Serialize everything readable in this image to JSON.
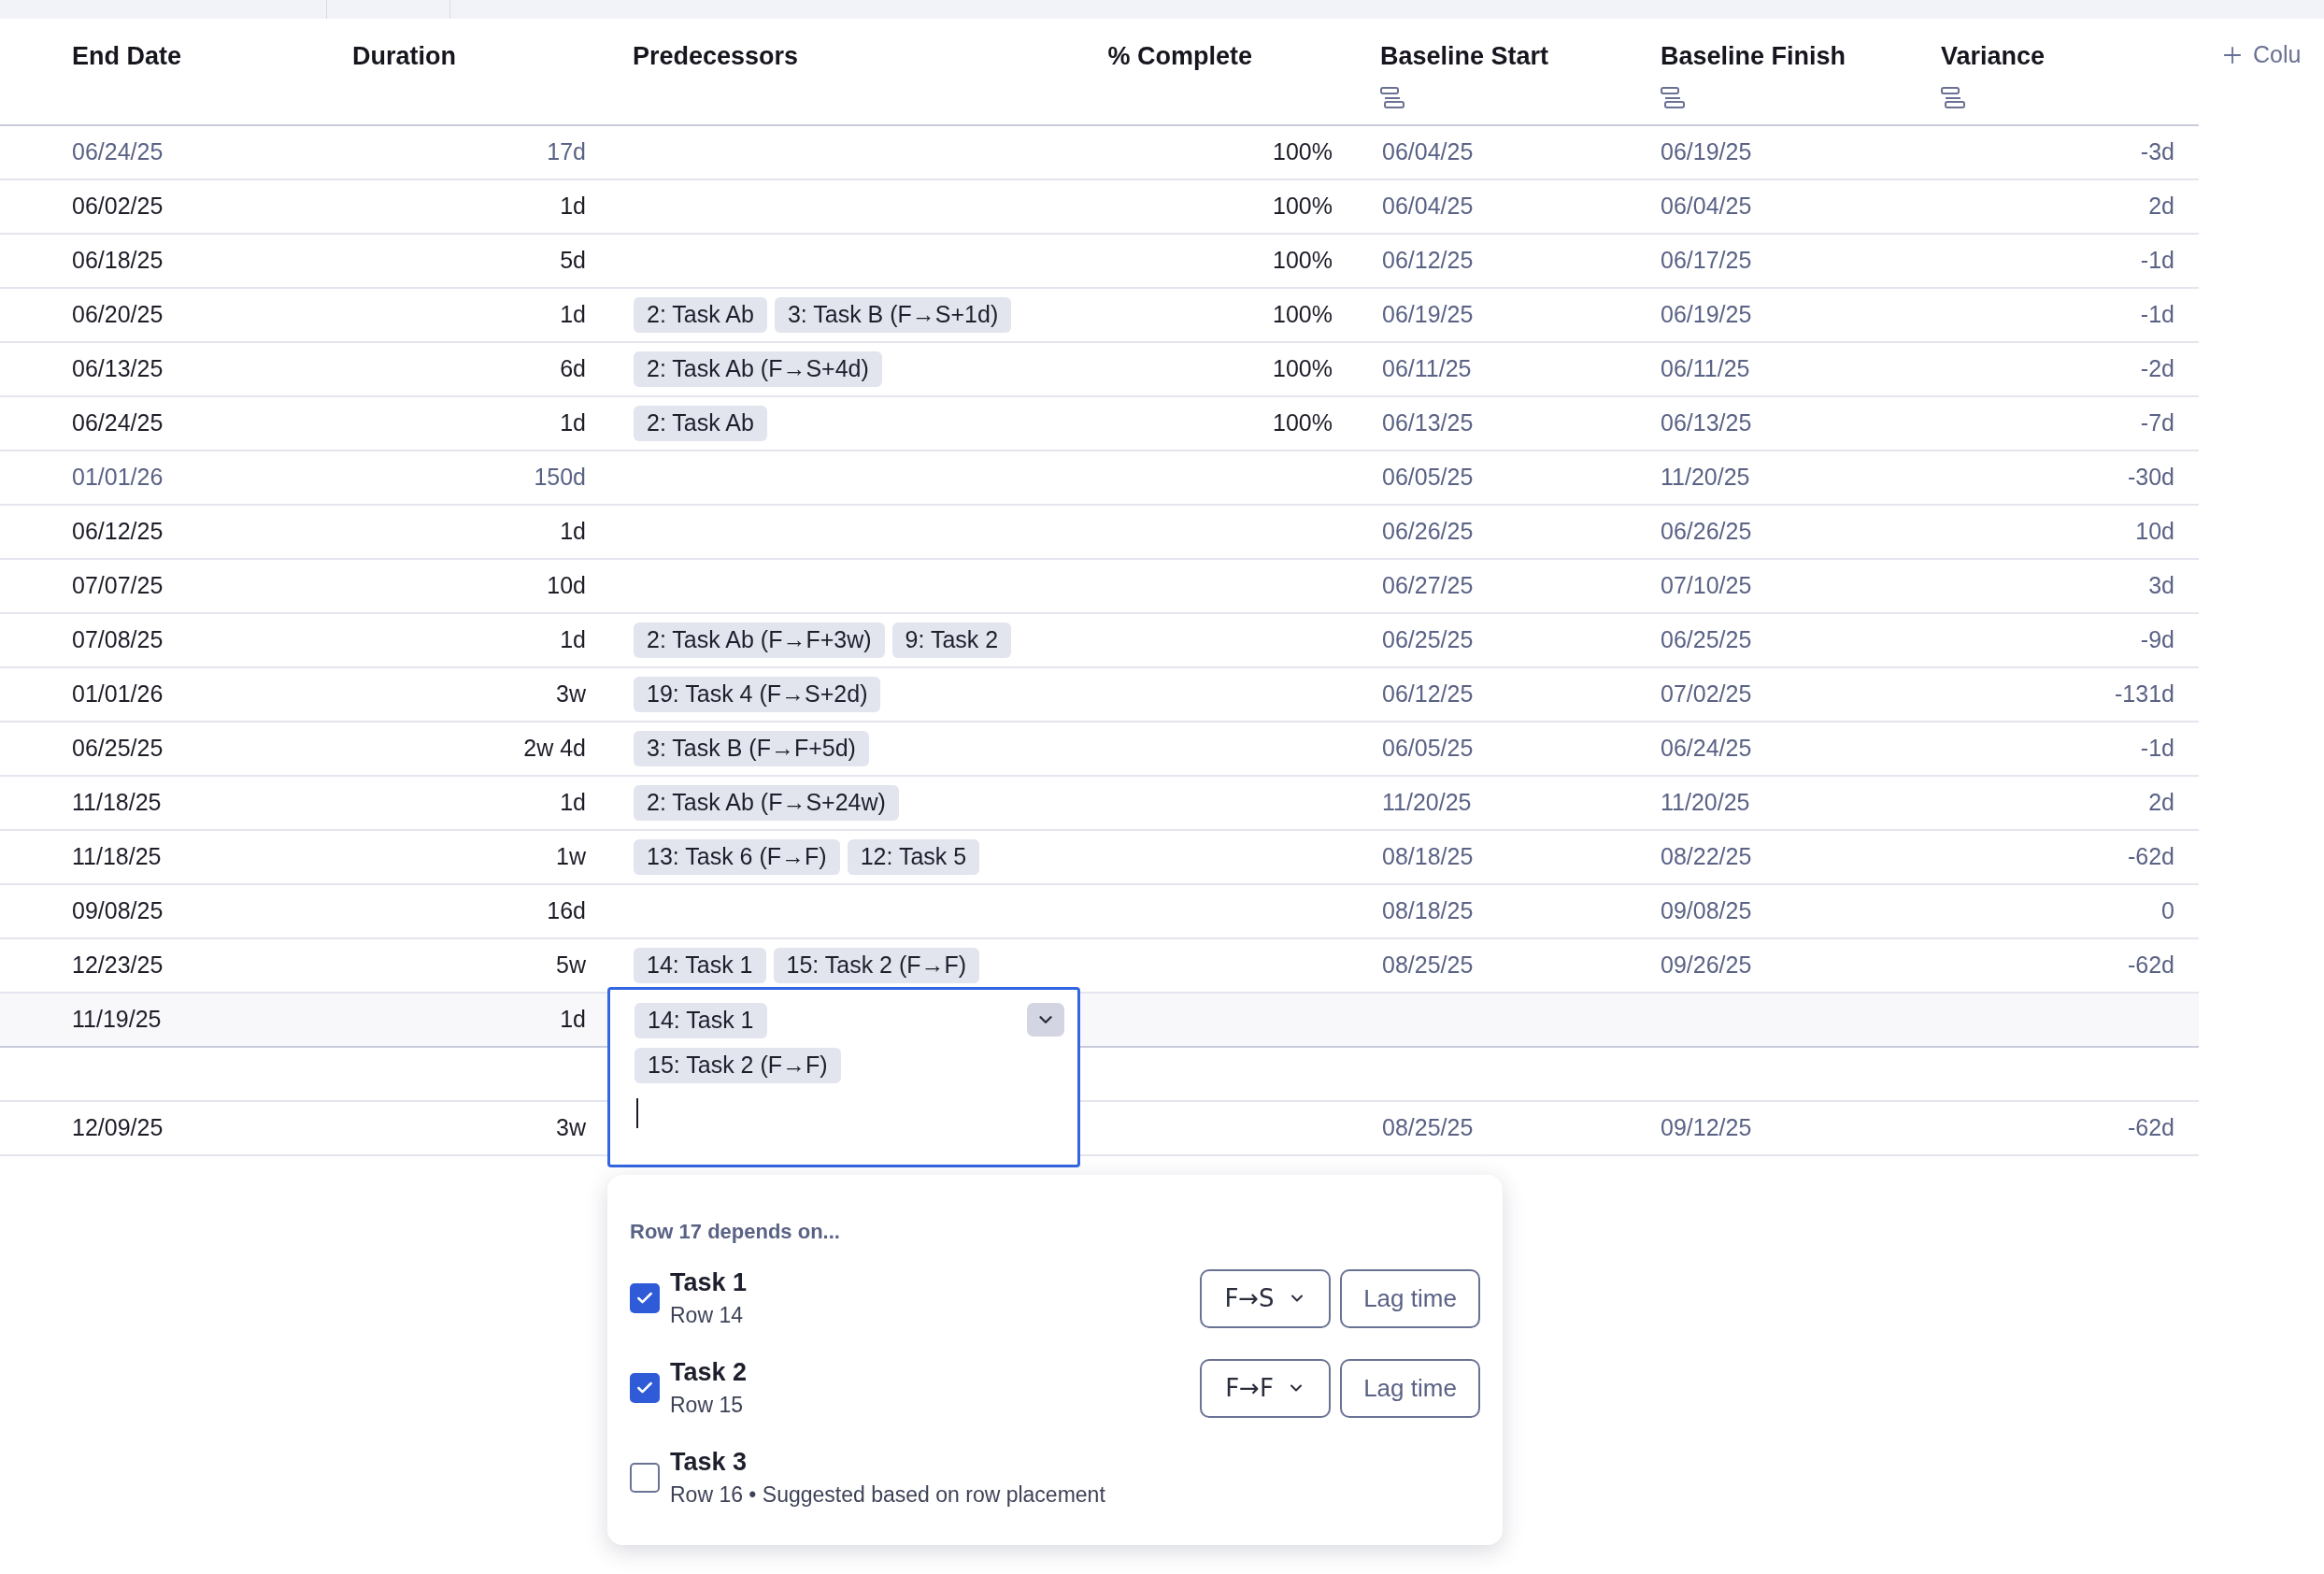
{
  "columns": [
    {
      "label": "End Date",
      "kind": "plain"
    },
    {
      "label": "Duration",
      "kind": "plain"
    },
    {
      "label": "Predecessors",
      "kind": "plain"
    },
    {
      "label": "% Complete",
      "kind": "plain"
    },
    {
      "label": "Baseline Start",
      "kind": "baseline"
    },
    {
      "label": "Baseline Finish",
      "kind": "baseline"
    },
    {
      "label": "Variance",
      "kind": "baseline"
    }
  ],
  "add_column": "Colu",
  "rows": [
    {
      "kind": "summary",
      "selected": false,
      "end": "06/24/25",
      "duration": "17d",
      "predecessors": [],
      "complete": "100%",
      "baseline_start": "06/04/25",
      "baseline_finish": "06/19/25",
      "variance": "-3d"
    },
    {
      "kind": "task",
      "selected": false,
      "end": "06/02/25",
      "duration": "1d",
      "predecessors": [],
      "complete": "100%",
      "baseline_start": "06/04/25",
      "baseline_finish": "06/04/25",
      "variance": "2d"
    },
    {
      "kind": "task",
      "selected": false,
      "end": "06/18/25",
      "duration": "5d",
      "predecessors": [],
      "complete": "100%",
      "baseline_start": "06/12/25",
      "baseline_finish": "06/17/25",
      "variance": "-1d"
    },
    {
      "kind": "task",
      "selected": false,
      "end": "06/20/25",
      "duration": "1d",
      "predecessors": [
        "2: Task Ab",
        "3: Task B (F→S+1d)"
      ],
      "complete": "100%",
      "baseline_start": "06/19/25",
      "baseline_finish": "06/19/25",
      "variance": "-1d"
    },
    {
      "kind": "task",
      "selected": false,
      "end": "06/13/25",
      "duration": "6d",
      "predecessors": [
        "2: Task Ab (F→S+4d)"
      ],
      "complete": "100%",
      "baseline_start": "06/11/25",
      "baseline_finish": "06/11/25",
      "variance": "-2d"
    },
    {
      "kind": "task",
      "selected": false,
      "end": "06/24/25",
      "duration": "1d",
      "predecessors": [
        "2: Task Ab"
      ],
      "complete": "100%",
      "baseline_start": "06/13/25",
      "baseline_finish": "06/13/25",
      "variance": "-7d"
    },
    {
      "kind": "summary",
      "selected": false,
      "end": "01/01/26",
      "duration": "150d",
      "predecessors": [],
      "baseline_start": "06/05/25",
      "baseline_finish": "11/20/25",
      "variance": "-30d"
    },
    {
      "kind": "task",
      "selected": false,
      "end": "06/12/25",
      "duration": "1d",
      "predecessors": [],
      "baseline_start": "06/26/25",
      "baseline_finish": "06/26/25",
      "variance": "10d"
    },
    {
      "kind": "task",
      "selected": false,
      "end": "07/07/25",
      "duration": "10d",
      "predecessors": [],
      "baseline_start": "06/27/25",
      "baseline_finish": "07/10/25",
      "variance": "3d"
    },
    {
      "kind": "task",
      "selected": false,
      "end": "07/08/25",
      "duration": "1d",
      "predecessors": [
        "2: Task Ab (F→F+3w)",
        "9: Task 2"
      ],
      "baseline_start": "06/25/25",
      "baseline_finish": "06/25/25",
      "variance": "-9d"
    },
    {
      "kind": "task",
      "selected": false,
      "end": "01/01/26",
      "duration": "3w",
      "predecessors": [
        "19: Task 4 (F→S+2d)"
      ],
      "baseline_start": "06/12/25",
      "baseline_finish": "07/02/25",
      "variance": "-131d"
    },
    {
      "kind": "task",
      "selected": false,
      "end": "06/25/25",
      "duration": "2w 4d",
      "predecessors": [
        "3: Task B (F→F+5d)"
      ],
      "baseline_start": "06/05/25",
      "baseline_finish": "06/24/25",
      "variance": "-1d"
    },
    {
      "kind": "task",
      "selected": false,
      "end": "11/18/25",
      "duration": "1d",
      "predecessors": [
        "2: Task Ab (F→S+24w)"
      ],
      "baseline_start": "11/20/25",
      "baseline_finish": "11/20/25",
      "variance": "2d"
    },
    {
      "kind": "task",
      "selected": false,
      "end": "11/18/25",
      "duration": "1w",
      "predecessors": [
        "13: Task 6 (F→F)",
        "12: Task 5"
      ],
      "baseline_start": "08/18/25",
      "baseline_finish": "08/22/25",
      "variance": "-62d"
    },
    {
      "kind": "task",
      "selected": false,
      "end": "09/08/25",
      "duration": "16d",
      "predecessors": [],
      "baseline_start": "08/18/25",
      "baseline_finish": "09/08/25",
      "variance": "0"
    },
    {
      "kind": "task",
      "selected": false,
      "end": "12/23/25",
      "duration": "5w",
      "predecessors": [
        "14: Task 1",
        "15: Task 2 (F→F)"
      ],
      "baseline_start": "08/25/25",
      "baseline_finish": "09/26/25",
      "variance": "-62d"
    },
    {
      "kind": "task",
      "selected": true,
      "end": "11/19/25",
      "duration": "1d",
      "predecessors": []
    },
    {
      "kind": "task",
      "selected": false,
      "predecessors": []
    },
    {
      "kind": "task",
      "selected": false,
      "end": "12/09/25",
      "duration": "3w",
      "predecessors": [],
      "baseline_start": "08/25/25",
      "baseline_finish": "09/12/25",
      "variance": "-62d"
    }
  ],
  "editor": {
    "chips": [
      "14: Task 1",
      "15: Task 2 (F→F)"
    ]
  },
  "popup": {
    "heading": "**Row 17** depends on...",
    "items": [
      {
        "title": "Task 1",
        "subtitle": "Row 14",
        "checked": true,
        "type": "F→S",
        "lag": "Lag time"
      },
      {
        "title": "Task 2",
        "subtitle": "Row 15",
        "checked": true,
        "type": "F→F",
        "lag": "Lag time"
      },
      {
        "title": "Task 3",
        "subtitle": "Row 16 • Suggested based on row placement",
        "checked": false
      }
    ]
  }
}
